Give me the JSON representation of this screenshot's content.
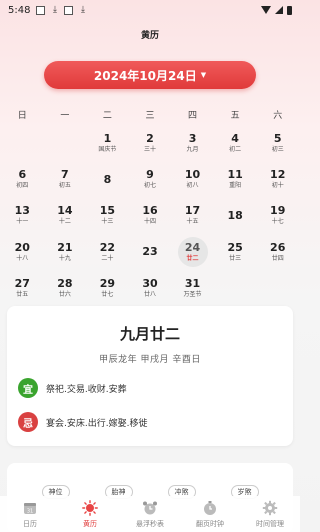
{
  "status_bar": {
    "time": "5:48"
  },
  "app": {
    "title": "黄历"
  },
  "date_selector": {
    "label": "2024年10月24日",
    "caret": "▼"
  },
  "weekdays": [
    "日",
    "一",
    "二",
    "三",
    "四",
    "五",
    "六"
  ],
  "calendar": {
    "leading_blanks": 2,
    "days": [
      {
        "num": "1",
        "lunar": "国庆节"
      },
      {
        "num": "2",
        "lunar": "三十"
      },
      {
        "num": "3",
        "lunar": "九月"
      },
      {
        "num": "4",
        "lunar": "初二"
      },
      {
        "num": "5",
        "lunar": "初三"
      },
      {
        "num": "6",
        "lunar": "初四"
      },
      {
        "num": "7",
        "lunar": "初五"
      },
      {
        "num": "8",
        "lunar": ""
      },
      {
        "num": "9",
        "lunar": "初七"
      },
      {
        "num": "10",
        "lunar": "初八"
      },
      {
        "num": "11",
        "lunar": "重阳"
      },
      {
        "num": "12",
        "lunar": "初十"
      },
      {
        "num": "13",
        "lunar": "十一"
      },
      {
        "num": "14",
        "lunar": "十二"
      },
      {
        "num": "15",
        "lunar": "十三"
      },
      {
        "num": "16",
        "lunar": "十四"
      },
      {
        "num": "17",
        "lunar": "十五"
      },
      {
        "num": "18",
        "lunar": ""
      },
      {
        "num": "19",
        "lunar": "十七"
      },
      {
        "num": "20",
        "lunar": "十八"
      },
      {
        "num": "21",
        "lunar": "十九"
      },
      {
        "num": "22",
        "lunar": "二十"
      },
      {
        "num": "23",
        "lunar": ""
      },
      {
        "num": "24",
        "lunar": "廿二"
      },
      {
        "num": "25",
        "lunar": "廿三"
      },
      {
        "num": "26",
        "lunar": "廿四"
      },
      {
        "num": "27",
        "lunar": "廿五"
      },
      {
        "num": "28",
        "lunar": "廿六"
      },
      {
        "num": "29",
        "lunar": "廿七"
      },
      {
        "num": "30",
        "lunar": "廿八"
      },
      {
        "num": "31",
        "lunar": "万圣节"
      }
    ],
    "selected_day": "24"
  },
  "almanac": {
    "lunar_date": "九月廿二",
    "ganzhi": "甲辰龙年  甲戌月  辛酉日",
    "yi_label": "宜",
    "yi_text": "祭祀.交易.收财.安葬",
    "ji_label": "忌",
    "ji_text": "宴会.安床.出行.嫁娶.移徙"
  },
  "tags": [
    "神位",
    "胎神",
    "冲煞",
    "岁煞"
  ],
  "bottom_nav": [
    {
      "label": "日历",
      "icon": "calendar-icon",
      "active": false
    },
    {
      "label": "黄历",
      "icon": "sun-icon",
      "active": true
    },
    {
      "label": "悬浮秒表",
      "icon": "alarm-clock-icon",
      "active": false
    },
    {
      "label": "翻页时钟",
      "icon": "flip-clock-icon",
      "active": false
    },
    {
      "label": "时间管理",
      "icon": "gear-icon",
      "active": false
    }
  ],
  "colors": {
    "accent": "#e03a3a",
    "yi": "#3aa42e",
    "ji": "#d94141"
  }
}
